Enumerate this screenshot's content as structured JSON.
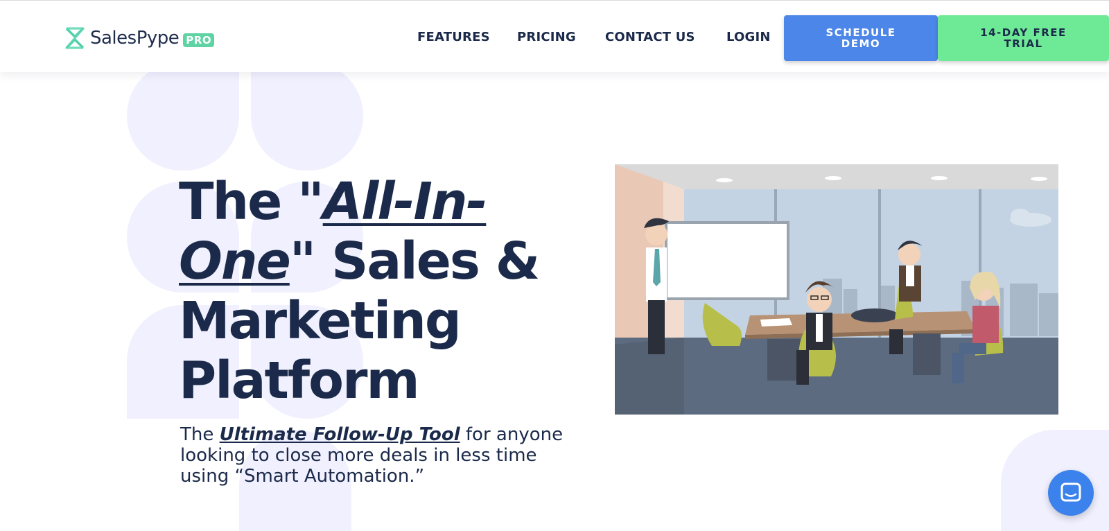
{
  "brand": {
    "name": "SalesPype",
    "badge": "PRO"
  },
  "nav": {
    "items": [
      {
        "label": "FEATURES"
      },
      {
        "label": "PRICING"
      },
      {
        "label": "CONTACT US"
      },
      {
        "label": "LOGIN"
      }
    ],
    "schedule_demo": "SCHEDULE DEMO",
    "free_trial": "14-DAY FREE TRIAL"
  },
  "hero": {
    "headline_prefix": "The \"",
    "headline_emphasis": "All-In-One",
    "headline_suffix": "\" Sales & Marketing Platform",
    "sub_prefix": "The ",
    "sub_emphasis": "Ultimate Follow-Up Tool",
    "sub_suffix": " for anyone looking to close more deals in less time using “Smart Automation.”"
  },
  "colors": {
    "navy": "#1b2a4a",
    "demo_blue": "#4c86e8",
    "trial_green": "#6ee996",
    "deco_lavender": "#f1f0fe",
    "chat_blue": "#3b82ec"
  },
  "icons": {
    "logo": "salespype-logo-icon",
    "chat": "chat-bubble-icon"
  }
}
